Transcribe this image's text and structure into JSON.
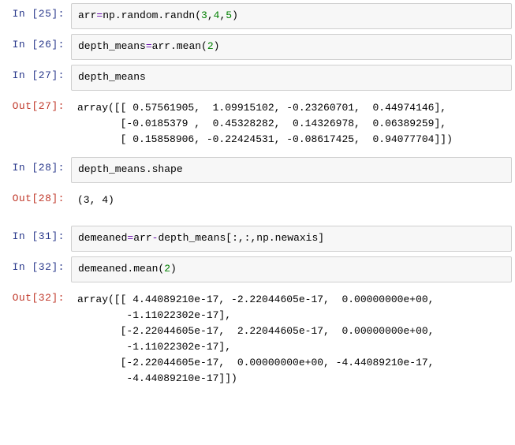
{
  "cells": [
    {
      "type": "in",
      "n": 25,
      "prompt": "In  [25]:",
      "code_html": "arr<span class='code-purple'>=</span>np.random.randn(<span class='code-green'>3</span>,<span class='code-green'>4</span>,<span class='code-green'>5</span>)"
    },
    {
      "type": "in",
      "n": 26,
      "prompt": "In  [26]:",
      "code_html": "depth_means<span class='code-purple'>=</span>arr.mean(<span class='code-green'>2</span>)"
    },
    {
      "type": "in",
      "n": 27,
      "prompt": "In  [27]:",
      "code_html": "depth_means"
    },
    {
      "type": "out",
      "n": 27,
      "prompt": "Out[27]:",
      "text": "array([[ 0.57561905,  1.09915102, -0.23260701,  0.44974146],\n       [-0.0185379 ,  0.45328282,  0.14326978,  0.06389259],\n       [ 0.15858906, -0.22424531, -0.08617425,  0.94077704]])"
    },
    {
      "type": "in",
      "n": 28,
      "prompt": "In  [28]:",
      "code_html": "depth_means.shape"
    },
    {
      "type": "out",
      "n": 28,
      "prompt": "Out[28]:",
      "text": "(3, 4)"
    },
    {
      "type": "spacer"
    },
    {
      "type": "in",
      "n": 31,
      "prompt": "In  [31]:",
      "code_html": "demeaned<span class='code-purple'>=</span>arr<span class='code-purple'>-</span>depth_means[:,:,np.newaxis]"
    },
    {
      "type": "in",
      "n": 32,
      "prompt": "In  [32]:",
      "code_html": "demeaned.mean(<span class='code-green'>2</span>)"
    },
    {
      "type": "out",
      "n": 32,
      "prompt": "Out[32]:",
      "text": "array([[ 4.44089210e-17, -2.22044605e-17,  0.00000000e+00,\n        -1.11022302e-17],\n       [-2.22044605e-17,  2.22044605e-17,  0.00000000e+00,\n        -1.11022302e-17],\n       [-2.22044605e-17,  0.00000000e+00, -4.44089210e-17,\n        -4.44089210e-17]])"
    }
  ]
}
